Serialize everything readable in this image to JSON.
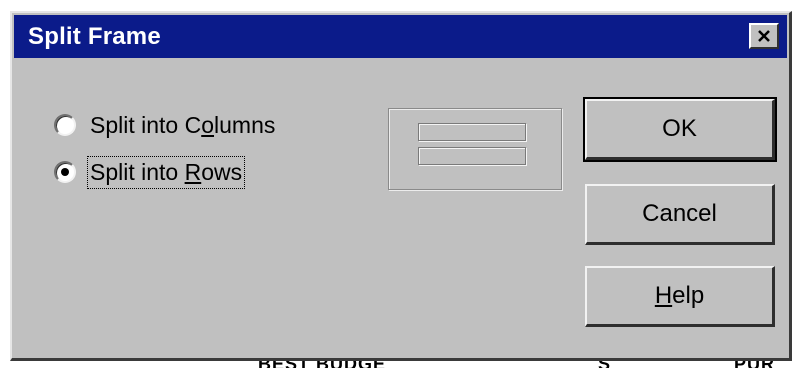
{
  "dialog": {
    "title": "Split Frame",
    "close_symbol": "✕"
  },
  "options": [
    {
      "label_before": "Split into C",
      "mnemonic": "o",
      "label_after": "lumns",
      "selected": false
    },
    {
      "label_before": "Split into ",
      "mnemonic": "R",
      "label_after": "ows",
      "selected": true
    }
  ],
  "buttons": {
    "ok": "OK",
    "cancel": "Cancel",
    "help_mnemonic": "H",
    "help_rest": "elp"
  },
  "background_text": [
    "BEST BUDGE",
    "S",
    "PUR"
  ],
  "icons": {
    "close": "close-icon",
    "preview": "rows-split-preview-icon"
  },
  "colors": {
    "titlebar": "#0b1b8a",
    "face": "#c0c0c0"
  }
}
